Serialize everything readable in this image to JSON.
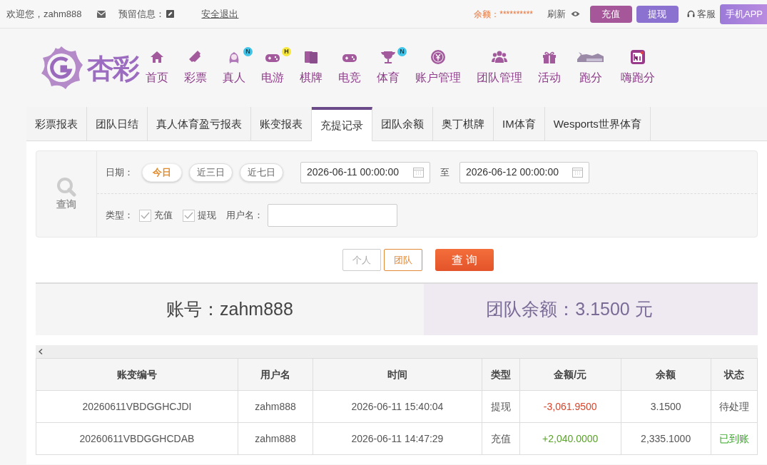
{
  "top_bar": {
    "welcome": "欢迎您，zahm888",
    "reserved_info_label": "预留信息：",
    "logout": "安全退出",
    "balance_label": "余额：",
    "balance_value": "**********",
    "refresh": "刷新",
    "deposit": "充值",
    "withdraw": "提现",
    "service": "客服",
    "app": "手机APP"
  },
  "logo": {
    "text": "杏彩"
  },
  "nav": [
    {
      "label": "首页"
    },
    {
      "label": "彩票"
    },
    {
      "label": "真人",
      "badge": "N",
      "color": "#40c4e8"
    },
    {
      "label": "电游",
      "badge": "H",
      "color": "#f5e63c"
    },
    {
      "label": "棋牌"
    },
    {
      "label": "电竞"
    },
    {
      "label": "体育",
      "badge": "N",
      "color": "#40c4e8"
    },
    {
      "label": "账户管理"
    },
    {
      "label": "团队管理"
    },
    {
      "label": "活动"
    },
    {
      "label": "跑分"
    },
    {
      "label": "嗨跑分"
    }
  ],
  "tabs": [
    {
      "label": "彩票报表",
      "selected": false
    },
    {
      "label": "团队日结",
      "selected": false
    },
    {
      "label": "真人体育盈亏报表",
      "selected": false
    },
    {
      "label": "账变报表",
      "selected": false
    },
    {
      "label": "充提记录",
      "selected": true
    },
    {
      "label": "团队余额",
      "selected": false
    },
    {
      "label": "奥丁棋牌",
      "selected": false
    },
    {
      "label": "IM体育",
      "selected": false
    },
    {
      "label": "Wesports世界体育",
      "selected": false
    }
  ],
  "filter": {
    "side_label": "查询",
    "date_label": "日期：",
    "presets": [
      {
        "label": "今日",
        "selected": true
      },
      {
        "label": "近三日",
        "selected": false
      },
      {
        "label": "近七日",
        "selected": false
      }
    ],
    "date_from": "2026-06-11 00:00:00",
    "to_label": "至",
    "date_to": "2026-06-12 00:00:00",
    "type_label": "类型：",
    "types": [
      {
        "label": "充值",
        "checked": true
      },
      {
        "label": "提现",
        "checked": true
      }
    ],
    "username_label": "用户名："
  },
  "scope": [
    {
      "label": "个人",
      "selected": false
    },
    {
      "label": "团队",
      "selected": true
    }
  ],
  "query_button": "查 询",
  "summary": {
    "account": "账号：zahm888",
    "team_balance": "团队余额：3.1500 元"
  },
  "table": {
    "columns": [
      "账变编号",
      "用户名",
      "时间",
      "类型",
      "金额/元",
      "余额",
      "状态"
    ],
    "rows": [
      {
        "kind": "withdraw",
        "credited": false,
        "cells": [
          "20260611VBDGGHCJDI",
          "zahm888",
          "2026-06-11 15:40:04",
          "提现",
          "-3,061.9500",
          "3.1500",
          "待处理"
        ]
      },
      {
        "kind": "deposit",
        "credited": true,
        "cells": [
          "20260611VBDGGHCDAB",
          "zahm888",
          "2026-06-11 14:47:29",
          "充值",
          "+2,040.0000",
          "2,335.1000",
          "已到账"
        ]
      }
    ]
  }
}
